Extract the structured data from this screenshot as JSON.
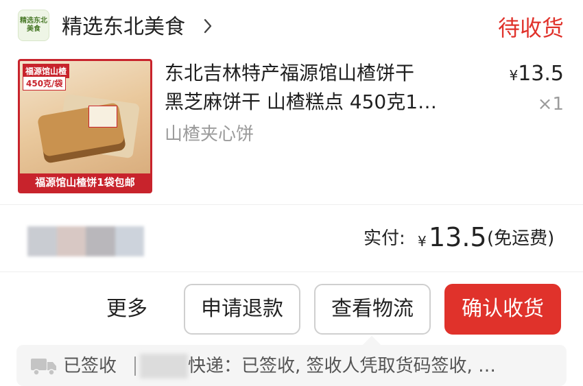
{
  "shop": {
    "logo_text": [
      "精选东北",
      "美食"
    ],
    "name": "精选东北美食",
    "status": "待收货"
  },
  "product": {
    "image_badge": "福源馆山楂",
    "image_badge2": "450克/袋",
    "image_caption": "福源馆山楂饼1袋包邮",
    "title_lines": [
      "东北吉林特产福源馆山楂饼干",
      "黑芝麻饼干 山楂糕点 450克1…"
    ],
    "sku": "山楂夹心饼",
    "price_symbol": "¥",
    "price": "13.5",
    "quantity": "×1"
  },
  "payment": {
    "label": "实付:",
    "currency": "¥",
    "amount": "13.5",
    "note": "(免运费)"
  },
  "actions": {
    "more": "更多",
    "refund": "申请退款",
    "view_logistics": "查看物流",
    "confirm_receipt": "确认收货"
  },
  "logistics": {
    "status": "已签收",
    "detail": "快递：已签收, 签收人凭取货码签收, …"
  },
  "colors": {
    "accent": "#e0322b",
    "muted_text": "#9b9b9b",
    "border": "#cfcfcf",
    "panel": "#f5f5f5"
  },
  "icons": {
    "shop_chevron": "chevron-right-icon",
    "truck": "truck-icon"
  }
}
